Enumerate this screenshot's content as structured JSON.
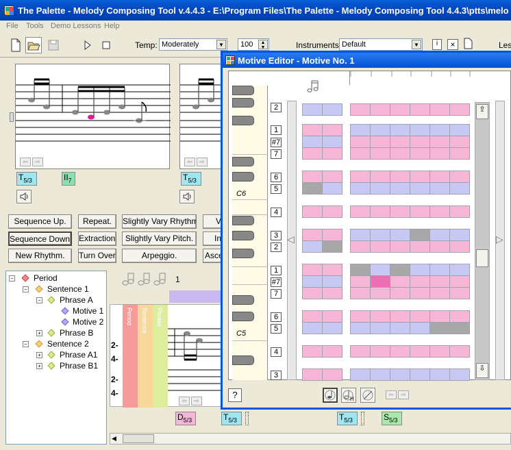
{
  "app": {
    "title": "The Palette - Melody Composing Tool v.4.4.3 - E:\\Program Files\\The Palette - Melody Composing Tool 4.4.3\\ptts\\melo",
    "menu": [
      "File",
      "Tools",
      "Demo Lessons",
      "Help"
    ]
  },
  "toolbar": {
    "temp_label": "Temp:",
    "temp_value": "Moderately",
    "bpm_value": "100",
    "instruments_label": "Instruments:",
    "instruments_value": "Default",
    "les_label": "Les"
  },
  "score": {
    "tag_t1": "T",
    "tag_t1_sub": "5/3",
    "tag_ii": "II",
    "tag_ii_sub": "7",
    "tag_t2": "T",
    "tag_t2_sub": "5/3"
  },
  "buttons": {
    "seq_up": "Sequence Up.",
    "repeat": "Repeat.",
    "slight_rhythm": "Slightly Vary Rhythm.",
    "v": "V",
    "seq_down": "Sequence Down.",
    "extraction": "Extraction.",
    "slight_pitch": "Slightly Vary Pitch.",
    "in": "In",
    "new_rhythm": "New Rhythm.",
    "turn_over": "Turn Over.",
    "arpeggio": "Arpeggio.",
    "asce": "Asce"
  },
  "tree": {
    "period": "Period",
    "sentence1": "Sentence 1",
    "phraseA": "Phrase A",
    "motive1": "Motive 1",
    "motive2": "Motive 2",
    "phraseB": "Phrase B",
    "sentence2": "Sentence 2",
    "phraseA1": "Phrase A1",
    "phraseB1": "Phrase B1"
  },
  "lower": {
    "measure_num": "1",
    "time_sig": [
      "2-",
      "4-",
      "2-",
      "4-"
    ],
    "col_labels": [
      "Period",
      "Sentence",
      "Phrase"
    ],
    "tag_d": "D",
    "tag_d_sub": "5/3",
    "tag_t3": "T",
    "tag_t3_sub": "5/3",
    "tag_t4": "T",
    "tag_t4_sub": "5/3",
    "tag_s": "S",
    "tag_s_sub": "5/3"
  },
  "motive_editor": {
    "title": "Motive Editor - Motive No. 1",
    "note_labels": [
      "2",
      "1",
      "#7",
      "7",
      "6",
      "5",
      "4",
      "3",
      "2",
      "1",
      "#7",
      "7",
      "6",
      "5",
      "4",
      "3"
    ],
    "octave_c6": "C6",
    "octave_c5": "C5",
    "help": "?"
  },
  "colors": {
    "pink": "#f6b7d6",
    "lavender": "#c8c8f4",
    "gray": "#a8a8a8",
    "hot": "#ee6fb4",
    "accent": "#0054e3"
  }
}
